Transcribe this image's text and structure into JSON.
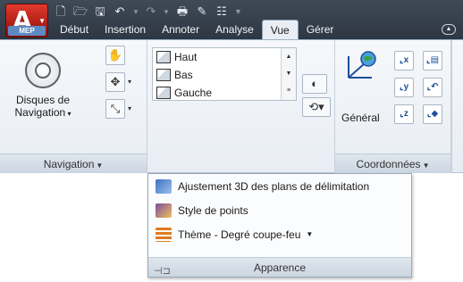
{
  "app": {
    "badge": "MEP"
  },
  "tabs": [
    "Début",
    "Insertion",
    "Annoter",
    "Analyse",
    "Vue",
    "Gérer"
  ],
  "active_tab": "Vue",
  "ribbon": {
    "navigation": {
      "disc_label_line1": "Disques de",
      "disc_label_line2": "Navigation",
      "title": "Navigation"
    },
    "views": {
      "items": [
        "Haut",
        "Bas",
        "Gauche"
      ]
    },
    "coordinates": {
      "general_label": "Général",
      "title": "Coordonnées"
    }
  },
  "flyout": {
    "items": [
      {
        "label": "Ajustement 3D des plans de délimitation",
        "icon": "clip-planes-icon",
        "color": "#3c6fc2"
      },
      {
        "label": "Style de points",
        "icon": "point-style-icon",
        "color": "#7b4b9c"
      },
      {
        "label": "Thème - Degré coupe-feu",
        "icon": "fire-rating-theme-icon",
        "color": "#e07a1f",
        "has_dropdown": true
      }
    ],
    "title": "Apparence"
  }
}
